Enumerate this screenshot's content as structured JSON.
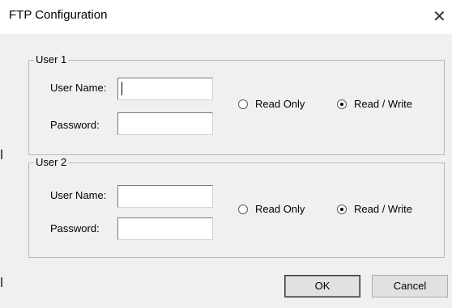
{
  "window": {
    "title": "FTP Configuration",
    "close_glyph": "✕"
  },
  "groups": [
    {
      "legend": "User 1",
      "username_label": "User Name:",
      "username_value": "",
      "password_label": "Password:",
      "password_value": "",
      "radio_read_only": "Read Only",
      "radio_read_write": "Read / Write",
      "selected": "Read / Write"
    },
    {
      "legend": "User 2",
      "username_label": "User Name:",
      "username_value": "",
      "password_label": "Password:",
      "password_value": "",
      "radio_read_only": "Read Only",
      "radio_read_write": "Read / Write",
      "selected": "Read / Write"
    }
  ],
  "buttons": {
    "ok": "OK",
    "cancel": "Cancel"
  },
  "icons": {
    "close": "close-icon",
    "radio_selected": "radio-selected-icon"
  }
}
